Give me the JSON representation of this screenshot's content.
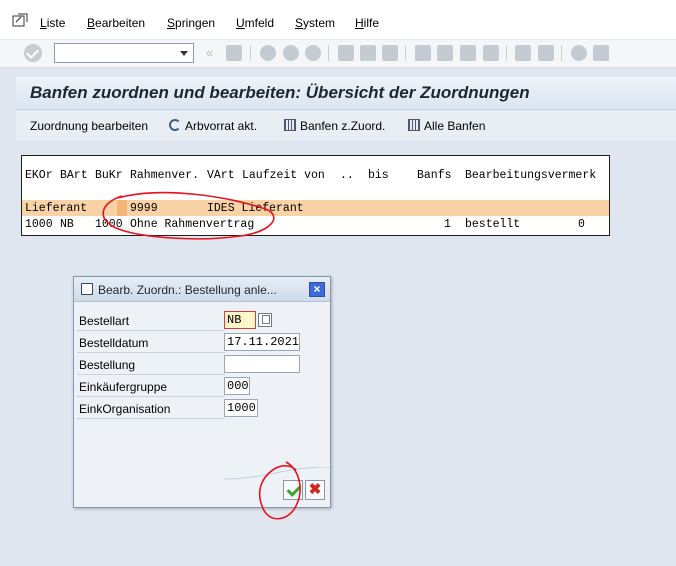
{
  "menu": {
    "items": [
      {
        "u": "L",
        "rest": "iste"
      },
      {
        "u": "B",
        "rest": "earbeiten"
      },
      {
        "u": "S",
        "rest": "pringen"
      },
      {
        "u": "U",
        "rest": "mfeld"
      },
      {
        "u": "S",
        "rest": "ystem"
      },
      {
        "u": "H",
        "rest": "ilfe"
      }
    ]
  },
  "toolbar": {
    "command_value": ""
  },
  "title": "Banfen zuordnen und bearbeiten: Übersicht der Zuordnungen",
  "app_toolbar": {
    "zuordnung": "Zuordnung bearbeiten",
    "arbvorrat": "Arbvorrat akt.",
    "banfen_zuord": "Banfen z.Zuord.",
    "alle_banfen": "Alle Banfen"
  },
  "list": {
    "header": {
      "ekor": "EKOr",
      "bart": "BArt",
      "bukr": "BuKr",
      "rahmenver": "Rahmenver.",
      "vart": "VArt",
      "laufzeit": "Laufzeit von",
      "dots": "..",
      "bis": "bis",
      "banfs": "Banfs",
      "bearbeitungsvermerk": "Bearbeitungsvermerk"
    },
    "group_row": {
      "label": "Lieferant",
      "number": "9999",
      "name": "IDES Lieferant"
    },
    "data_row": {
      "ekor": "1000",
      "bart": "NB",
      "bukr": "1000",
      "rahmenvertrag": "Ohne Rahmenvertrag",
      "banfs": "1",
      "vermerk": "bestellt",
      "count": "0"
    }
  },
  "dialog": {
    "title": "Bearb. Zuordn.: Bestellung anle...",
    "fields": {
      "bestellart": {
        "label": "Bestellart",
        "value": "NB"
      },
      "bestelldatum": {
        "label": "Bestelldatum",
        "value": "17.11.2021"
      },
      "bestellung": {
        "label": "Bestellung",
        "value": ""
      },
      "einkaeufergruppe": {
        "label": "Einkäufergruppe",
        "value": "000"
      },
      "einkorganisation": {
        "label": "EinkOrganisation",
        "value": "1000"
      }
    },
    "close_symbol": "×",
    "cancel_symbol": "✖"
  },
  "annotation_color": "#e8141c"
}
